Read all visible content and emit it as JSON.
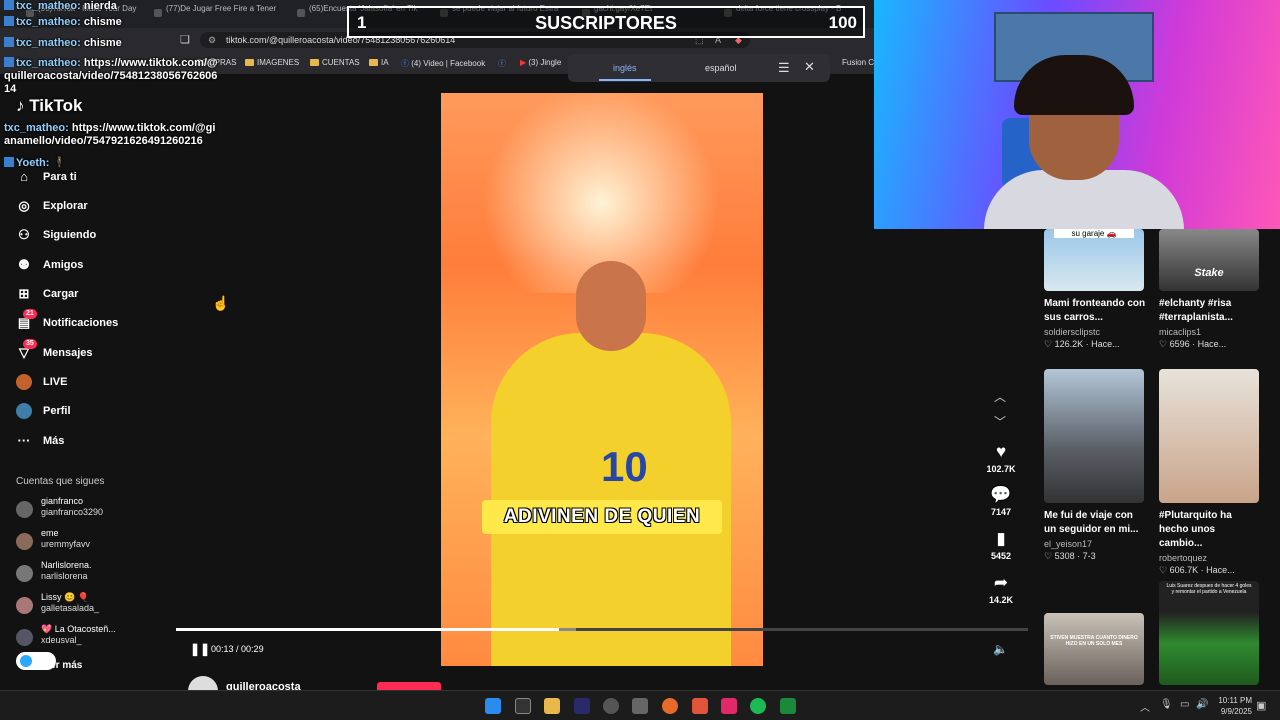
{
  "browser": {
    "tabs": [
      {
        "label": "(56)TikTok - Make Your Day"
      },
      {
        "label": "(77)De Jugar Free Fire a Tener"
      },
      {
        "label": "(65)Encuesta 'Jalasofía' en Tik"
      },
      {
        "label": "se puede viajar al futuro Estra"
      },
      {
        "label": "gachi.gay/Xe7Et"
      },
      {
        "label": "delta force tiene crossplay - B"
      }
    ],
    "url": "tiktok.com/@quilleroacosta/video/7548123805676260614",
    "bookmarks": [
      {
        "label": "COMPRAS"
      },
      {
        "label": "IMAGENES"
      },
      {
        "label": "CUENTAS"
      },
      {
        "label": "IA"
      },
      {
        "label": "(4) Video | Facebook"
      },
      {
        "label": "(3) Jingle"
      },
      {
        "label": "Fusion C"
      }
    ]
  },
  "overlay": {
    "sub_left": "1",
    "sub_title": "SUSCRIPTORES",
    "sub_right": "100"
  },
  "translate": {
    "lang_from": "inglés",
    "lang_to": "español"
  },
  "chat": [
    {
      "user": "txc_matheo:",
      "text": "nierda"
    },
    {
      "user": "txc_matheo:",
      "text": "chisme"
    },
    {
      "user": "txc_matheo:",
      "text": "chisme"
    },
    {
      "user": "txc_matheo:",
      "text": "https://www.tiktok.com/@quilleroacosta/video/7548123805676260614"
    },
    {
      "user": "txc_matheo:",
      "text": "https://www.tiktok.com/@gianamello/video/7547921626491260216"
    },
    {
      "user": "Yoeth:",
      "text": "🕴"
    }
  ],
  "tiktok": {
    "logo": "TikTok",
    "nav": [
      {
        "label": "Para ti",
        "icon": "home-icon"
      },
      {
        "label": "Explorar",
        "icon": "compass-icon"
      },
      {
        "label": "Siguiendo",
        "icon": "following-icon"
      },
      {
        "label": "Amigos",
        "icon": "friends-icon"
      },
      {
        "label": "Cargar",
        "icon": "upload-icon"
      },
      {
        "label": "Notificaciones",
        "icon": "inbox-icon",
        "badge": "21"
      },
      {
        "label": "Mensajes",
        "icon": "messages-icon",
        "badge": "35"
      },
      {
        "label": "LIVE",
        "icon": "live-icon"
      },
      {
        "label": "Perfil",
        "icon": "profile-icon"
      },
      {
        "label": "Más",
        "icon": "more-icon"
      }
    ],
    "following_title": "Cuentas que sigues",
    "following": [
      {
        "name": "gianfranco",
        "handle": "gianfranco3290"
      },
      {
        "name": "eme",
        "handle": "uremmyfavv"
      },
      {
        "name": "Narlislorena.",
        "handle": "narlislorena"
      },
      {
        "name": "Lissy 😊 🎈",
        "handle": "galletasalada_"
      },
      {
        "name": "💖 La Otacosteñ...",
        "handle": "xdeusval_"
      }
    ],
    "see_more": "Ver más"
  },
  "video": {
    "caption": "ADIVINEN DE QUIEN",
    "time_current": "00:13",
    "time_total": "00:29",
    "progress": 0.45,
    "buffered": 0.47,
    "author": "quilleroacosta"
  },
  "actions": [
    {
      "icon": "heart-icon",
      "value": "102.7K"
    },
    {
      "icon": "comment-icon",
      "value": "7147"
    },
    {
      "icon": "bookmark-icon",
      "value": "5452"
    },
    {
      "icon": "share-icon",
      "value": "14.2K"
    }
  ],
  "recommended": [
    {
      "thumb_text": "su garaje 🚗",
      "title": "Mami fronteando con sus carros...",
      "user": "soldiersclipstc",
      "stats": "♡ 126.2K · Hace..."
    },
    {
      "thumb_text": "Stake",
      "title": "#elchanty #risa #terraplanista...",
      "user": "micaclips1",
      "stats": "♡ 6596 · Hace..."
    },
    {
      "thumb_text": "",
      "title": "Me fui de viaje con un seguidor en mi...",
      "user": "el_yeison17",
      "stats": "♡ 5308 · 7-3"
    },
    {
      "thumb_text": "",
      "title": "#Plutarquito ha hecho unos cambio...",
      "user": "robertoquez",
      "stats": "♡ 606.7K · Hace..."
    },
    {
      "thumb_text": "STIVEN MUESTRA CUANTO DINERO HIZO EN UN SOLO MES",
      "title": "",
      "user": "",
      "stats": ""
    },
    {
      "thumb_text": "Luis Suarez despues de hacer 4 goles y remontar el partido a Venezuela",
      "title": "",
      "user": "",
      "stats": ""
    }
  ],
  "taskbar": {
    "time": "10:11 PM",
    "date": "9/9/2025"
  }
}
